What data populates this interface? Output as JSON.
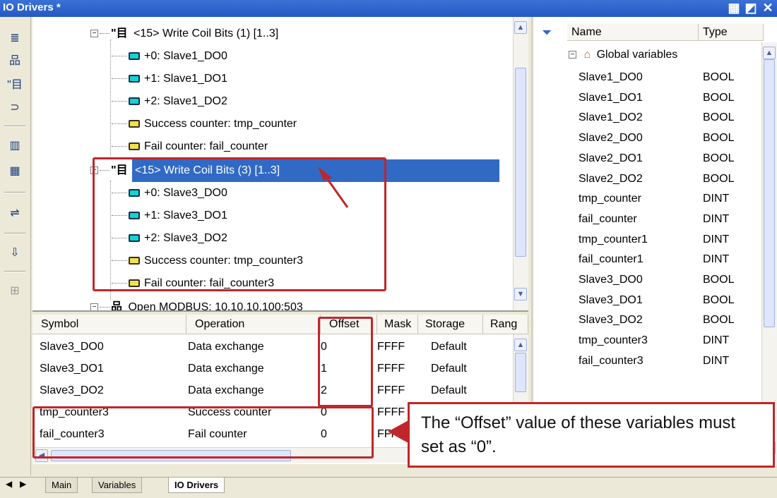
{
  "window": {
    "title": "IO Drivers *"
  },
  "tree": {
    "items": [
      {
        "type": "coil",
        "label": "<15> Write Coil Bits (1) [1..3]"
      },
      {
        "type": "var",
        "label": "+0: Slave1_DO0"
      },
      {
        "type": "var",
        "label": "+1: Slave1_DO1"
      },
      {
        "type": "var",
        "label": "+2: Slave1_DO2"
      },
      {
        "type": "counter",
        "label": "Success counter: tmp_counter"
      },
      {
        "type": "counter",
        "label": "Fail counter: fail_counter"
      },
      {
        "type": "coil",
        "label": "<15> Write Coil Bits (3) [1..3]",
        "selected": true
      },
      {
        "type": "var",
        "label": "+0: Slave3_DO0"
      },
      {
        "type": "var",
        "label": "+1: Slave3_DO1"
      },
      {
        "type": "var",
        "label": "+2: Slave3_DO2"
      },
      {
        "type": "counter",
        "label": "Success counter: tmp_counter3"
      },
      {
        "type": "counter",
        "label": "Fail counter: fail_counter3"
      },
      {
        "type": "modbus",
        "label": "Open MODBUS: 10.10.10.100:503"
      }
    ]
  },
  "variables": {
    "headers": {
      "name": "Name",
      "type": "Type"
    },
    "group": "Global variables",
    "rows": [
      {
        "name": "Slave1_DO0",
        "type": "BOOL"
      },
      {
        "name": "Slave1_DO1",
        "type": "BOOL"
      },
      {
        "name": "Slave1_DO2",
        "type": "BOOL"
      },
      {
        "name": "Slave2_DO0",
        "type": "BOOL"
      },
      {
        "name": "Slave2_DO1",
        "type": "BOOL"
      },
      {
        "name": "Slave2_DO2",
        "type": "BOOL"
      },
      {
        "name": "tmp_counter",
        "type": "DINT"
      },
      {
        "name": "fail_counter",
        "type": "DINT"
      },
      {
        "name": "tmp_counter1",
        "type": "DINT"
      },
      {
        "name": "fail_counter1",
        "type": "DINT"
      },
      {
        "name": "Slave3_DO0",
        "type": "BOOL"
      },
      {
        "name": "Slave3_DO1",
        "type": "BOOL"
      },
      {
        "name": "Slave3_DO2",
        "type": "BOOL"
      },
      {
        "name": "tmp_counter3",
        "type": "DINT"
      },
      {
        "name": "fail_counter3",
        "type": "DINT"
      }
    ]
  },
  "grid": {
    "headers": {
      "symbol": "Symbol",
      "operation": "Operation",
      "offset": "Offset",
      "mask": "Mask",
      "storage": "Storage",
      "range": "Rang"
    },
    "rows": [
      {
        "symbol": "Slave3_DO0",
        "operation": "Data exchange",
        "offset": "0",
        "mask": "FFFF",
        "storage": "Default"
      },
      {
        "symbol": "Slave3_DO1",
        "operation": "Data exchange",
        "offset": "1",
        "mask": "FFFF",
        "storage": "Default"
      },
      {
        "symbol": "Slave3_DO2",
        "operation": "Data exchange",
        "offset": "2",
        "mask": "FFFF",
        "storage": "Default"
      },
      {
        "symbol": "tmp_counter3",
        "operation": "Success counter",
        "offset": "0",
        "mask": "FFFF",
        "storage": ""
      },
      {
        "symbol": "fail_counter3",
        "operation": "Fail counter",
        "offset": "0",
        "mask": "FFFF",
        "storage": ""
      }
    ]
  },
  "tabs": {
    "main": "Main",
    "variables": "Variables",
    "io_drivers": "IO Drivers"
  },
  "callout": {
    "text": "The “Offset” value of these variables must set as “0”."
  },
  "colors": {
    "accent": "#c0262a",
    "selection": "#316ac5",
    "titlebar": "#2458c4"
  }
}
